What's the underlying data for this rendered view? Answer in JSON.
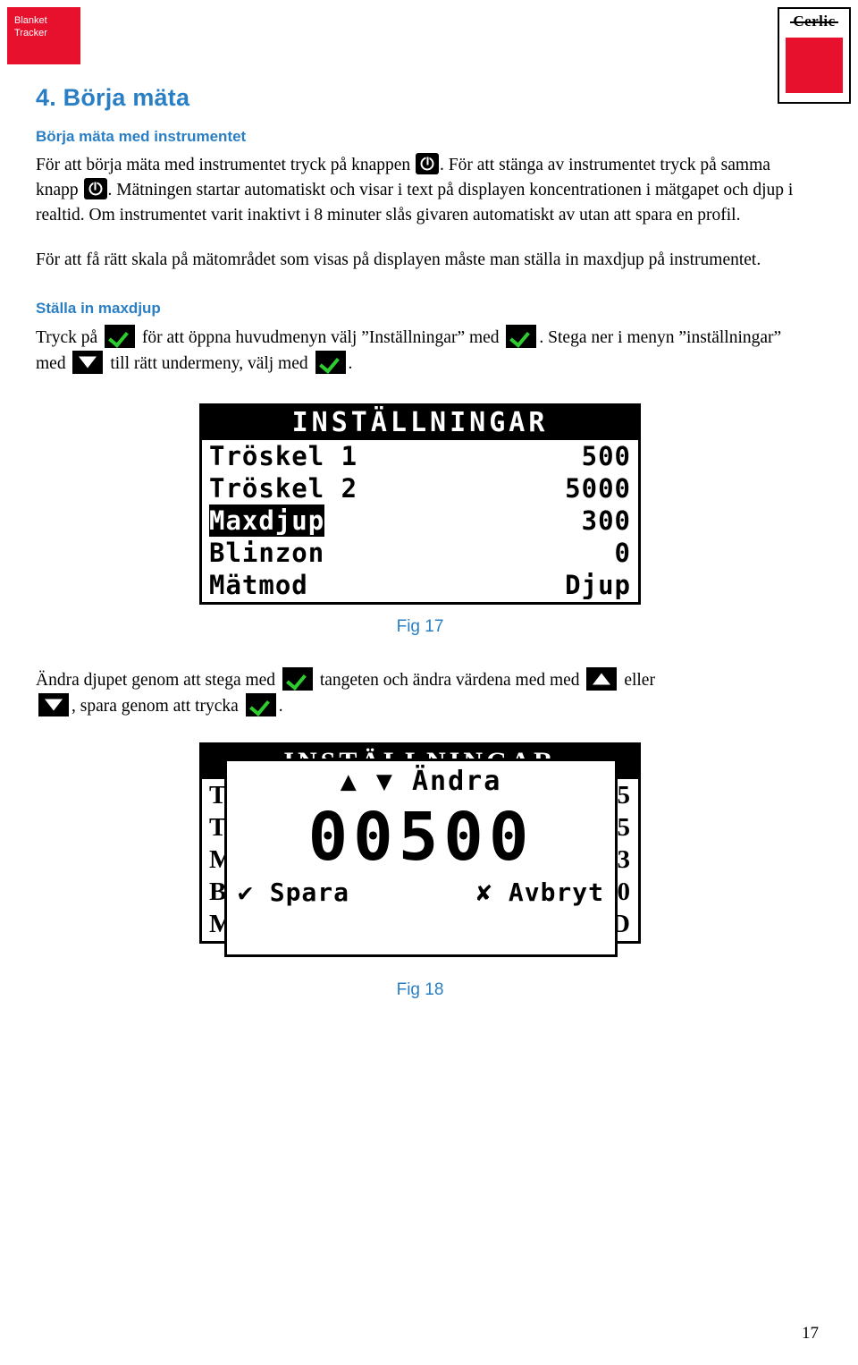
{
  "header": {
    "logo_line1": "Blanket",
    "logo_line2": "Tracker",
    "brand": "Cerlic",
    "brand_accent": "#e8112d"
  },
  "section": {
    "number_title": "4. Börja mäta",
    "subtitle": "Börja mäta med instrumentet",
    "para1_a": "För att börja mäta med instrumentet tryck på knappen",
    "para1_b": ". För att stänga av",
    "para1_c": "instrumentet tryck på samma knapp",
    "para1_d": ". Mätningen startar automatiskt och visar i text på displayen koncentrationen i mätgapet och djup i realtid. Om instrumentet varit inaktivt i 8 minuter slås givaren automatiskt av utan att spara en profil.",
    "para2": "För att få rätt skala på mätområdet som visas på displayen måste man ställa in maxdjup på instrumentet.",
    "subtitle2": "Ställa in maxdjup",
    "para3_a": "Tryck på",
    "para3_b": "för att öppna huvudmenyn välj ”Inställningar” med",
    "para3_c": ". Stega ner i",
    "para3_d": "menyn ”inställningar” med",
    "para3_e": "till rätt undermeny, välj med",
    "para3_f": ".",
    "para4_a": "Ändra djupet genom att stega med",
    "para4_b": "tangeten och ändra värdena med med",
    "para4_c": "eller",
    "para4_d": ", spara genom att trycka",
    "para4_e": "."
  },
  "fig17": {
    "title": "INSTÄLLNINGAR",
    "rows": [
      {
        "label": "Tröskel 1",
        "value": "500",
        "highlight": false
      },
      {
        "label": "Tröskel 2",
        "value": "5000",
        "highlight": false
      },
      {
        "label": "Maxdjup",
        "value": "300",
        "highlight": true
      },
      {
        "label": "Blinzon",
        "value": "0",
        "highlight": false
      },
      {
        "label": "Mätmod",
        "value": "Djup",
        "highlight": false
      }
    ],
    "caption": "Fig 17"
  },
  "fig18": {
    "bg_title": "INSTÄLLNINGAR",
    "bg_rows": [
      {
        "label": "T",
        "value": "5"
      },
      {
        "label": "T",
        "value": "5"
      },
      {
        "label": "M",
        "value": "3"
      },
      {
        "label": "B",
        "value": "0"
      },
      {
        "label": "M",
        "value": "D"
      }
    ],
    "dialog_head": "▲ ▼ Ändra",
    "dialog_value": "00500",
    "dialog_save": "✔ Spara",
    "dialog_cancel": "✘ Avbryt",
    "caption": "Fig 18"
  },
  "footer": {
    "page_number": "17"
  },
  "icons": {
    "power": "power-button-icon",
    "check": "check-button-icon",
    "arrow_down": "arrow-down-button-icon",
    "arrow_up": "arrow-up-button-icon"
  }
}
